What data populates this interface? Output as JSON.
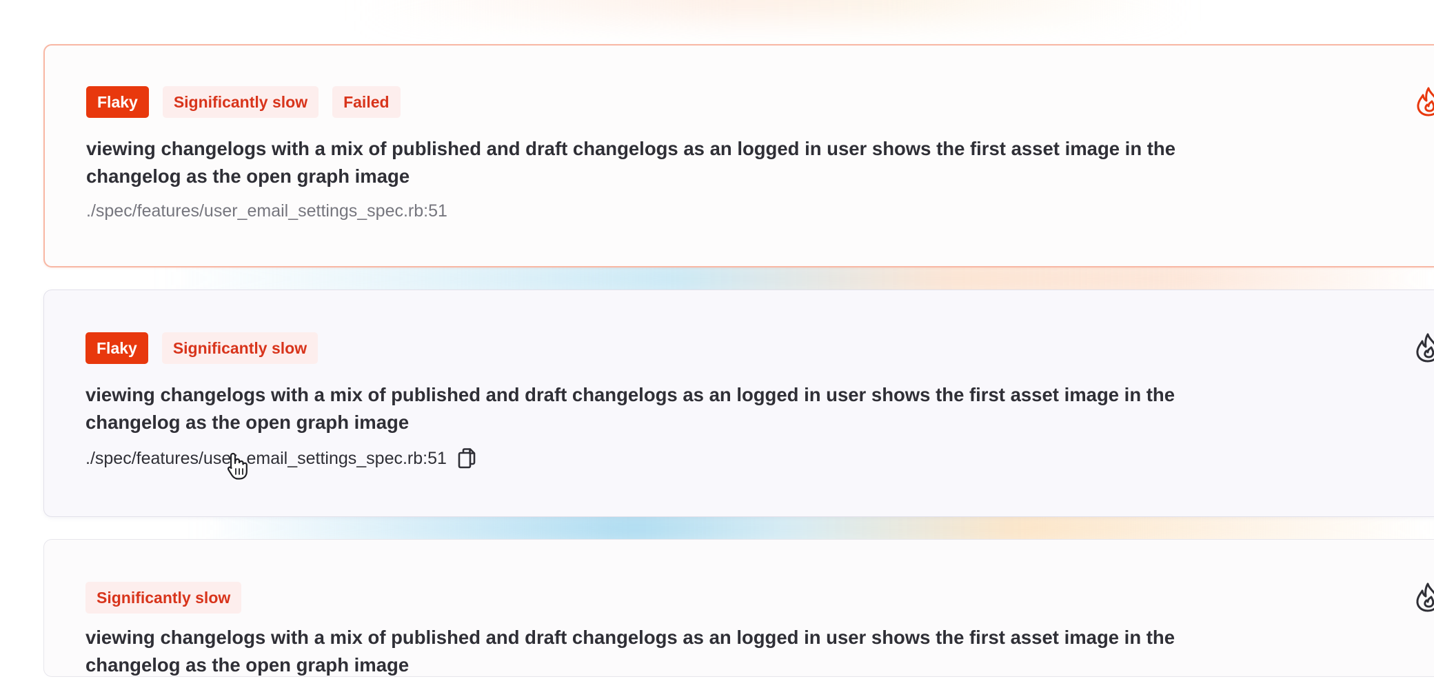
{
  "colors": {
    "accent": "#e8380d",
    "badge_soft_bg": "#fdeeed",
    "badge_soft_text": "#d8341b",
    "active_border": "#f8b7a4"
  },
  "cards": [
    {
      "badges": [
        "Flaky",
        "Significantly slow",
        "Failed"
      ],
      "title": "viewing changelogs with a mix of published and draft changelogs as an logged in user shows the first asset image in the changelog as the open graph image",
      "path": "./spec/features/user_email_settings_spec.rb:51",
      "icon": "flame-icon",
      "state": "selected"
    },
    {
      "badges": [
        "Flaky",
        "Significantly slow"
      ],
      "title": "viewing changelogs with a mix of published and draft changelogs as an logged in user shows the first asset image in the changelog as the open graph image",
      "path": "./spec/features/user_email_settings_spec.rb:51",
      "copy_icon": "copy-icon",
      "icon": "flame-icon",
      "state": "hover"
    },
    {
      "badges": [
        "Significantly slow"
      ],
      "title": "viewing changelogs with a mix of published and draft changelogs as an logged in user shows the first asset image in the changelog as the open graph image",
      "icon": "flame-icon",
      "state": "default"
    }
  ],
  "cursor": "hand-pointer-icon"
}
